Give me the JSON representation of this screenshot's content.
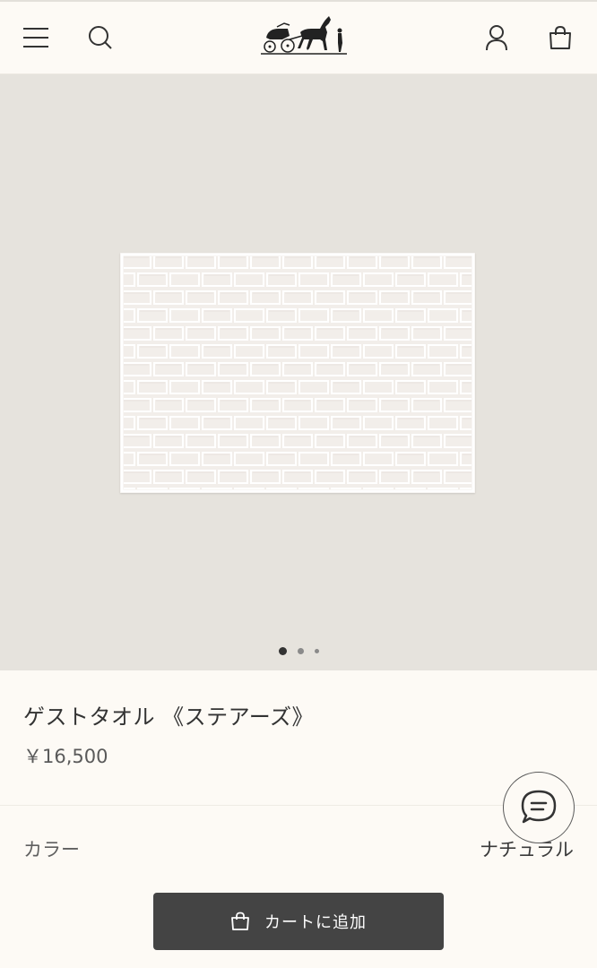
{
  "header": {
    "menu_icon": "hamburger-menu-icon",
    "search_icon": "search-icon",
    "logo_icon": "carriage-logo-icon",
    "account_icon": "user-icon",
    "bag_icon": "shopping-bag-icon"
  },
  "gallery": {
    "image_count": 3,
    "active_index": 1
  },
  "product": {
    "title": "ゲストタオル 《ステアーズ》",
    "price": "￥16,500"
  },
  "chat": {
    "icon": "chat-bubble-icon"
  },
  "color": {
    "label": "カラー",
    "value": "ナチュラル"
  },
  "cart": {
    "label": "カートに追加",
    "icon": "shopping-bag-icon"
  },
  "colors": {
    "background": "#fdfaf5",
    "gallery_bg": "#e6e3dd",
    "button": "#444444"
  }
}
